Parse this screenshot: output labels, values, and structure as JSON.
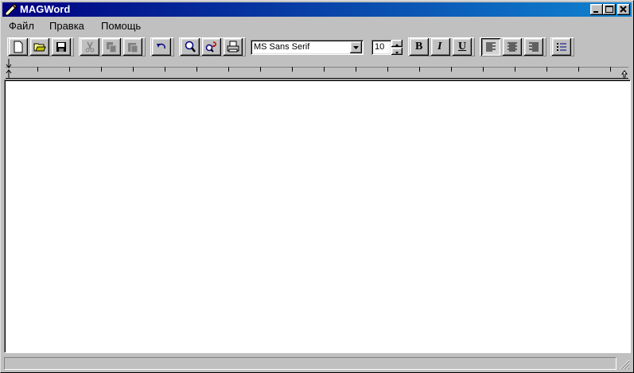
{
  "window": {
    "title": "MAGWord"
  },
  "title_buttons": {
    "minimize": "minimize-icon",
    "maximize": "maximize-icon",
    "close": "close-icon"
  },
  "menu": {
    "items": [
      "Файл",
      "Правка",
      "Помощь"
    ]
  },
  "toolbar": {
    "buttons": [
      "new-document-icon",
      "open-folder-icon",
      "save-icon",
      "cut-icon",
      "copy-icon",
      "paste-icon",
      "undo-icon",
      "find-icon",
      "replace-icon",
      "print-icon",
      "bold-icon",
      "italic-icon",
      "underline-icon",
      "align-left-icon",
      "align-center-icon",
      "align-right-icon",
      "bullets-icon"
    ],
    "font_name": "MS Sans Serif",
    "font_size": "10",
    "bold_label": "B",
    "italic_label": "I",
    "underline_label": "U",
    "align_left_pressed": true
  },
  "editor": {
    "text": ""
  },
  "colors": {
    "title_start": "#000080",
    "title_end": "#1084d0",
    "face": "#c0c0c0"
  }
}
